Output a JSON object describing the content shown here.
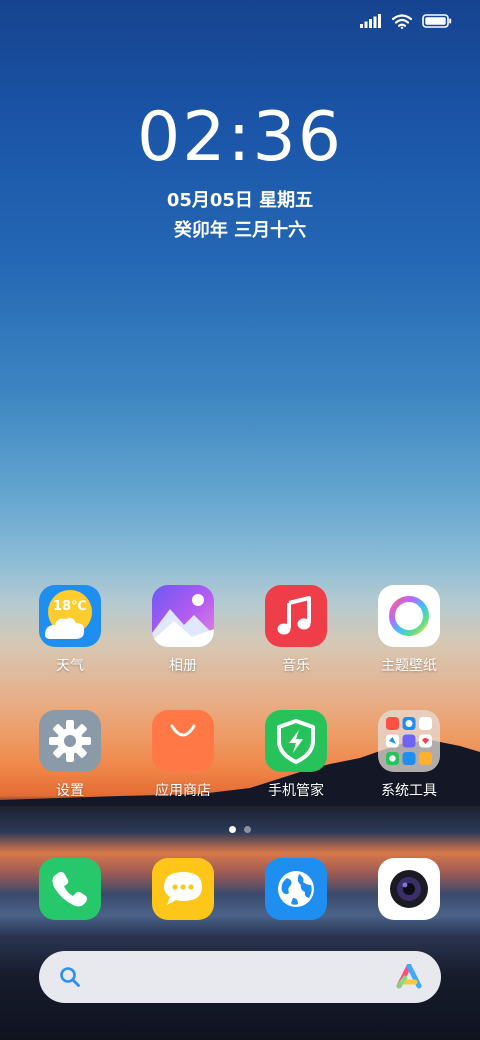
{
  "status_bar": {
    "icons": [
      "signal-icon",
      "wifi-icon",
      "battery-icon"
    ]
  },
  "lock": {
    "time": "02:36",
    "date": "05月05日 星期五",
    "lunar": "癸卯年 三月十六"
  },
  "apps": {
    "weather": {
      "label": "天气",
      "temp": "18℃"
    },
    "gallery": {
      "label": "相册"
    },
    "music": {
      "label": "音乐"
    },
    "themes": {
      "label": "主题壁纸"
    },
    "settings": {
      "label": "设置"
    },
    "app_store": {
      "label": "应用商店"
    },
    "security": {
      "label": "手机管家"
    },
    "tools": {
      "label": "系统工具"
    }
  },
  "dock": {
    "items": [
      "phone-icon",
      "messages-icon",
      "browser-icon",
      "camera-icon"
    ]
  },
  "pager": {
    "pages": 2,
    "current": 1
  },
  "search": {
    "icons": [
      "search-icon",
      "assistant-icon"
    ]
  },
  "colors": {
    "weather_bg": "#1e8ff0",
    "gallery_bg": "#7b5cf2",
    "music_bg": "#ef3e4a",
    "themes_bg": "#ffffff",
    "settings_bg": "#8a9aa8",
    "app_store_bg": "#ff7846",
    "security_bg": "#27c25a",
    "phone_bg": "#27c76b",
    "messages_bg": "#ffc61a",
    "browser_bg": "#1e8ff0",
    "camera_bg": "#ffffff"
  }
}
